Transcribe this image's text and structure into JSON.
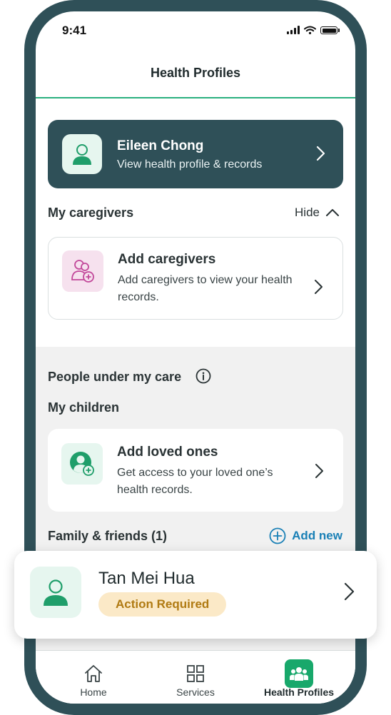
{
  "status_bar": {
    "time": "9:41"
  },
  "header": {
    "title": "Health Profiles"
  },
  "profile_card": {
    "name": "Eileen Chong",
    "subtitle": "View health profile & records"
  },
  "caregivers": {
    "section_title": "My caregivers",
    "toggle_label": "Hide",
    "card": {
      "title": "Add caregivers",
      "description": "Add caregivers to view your health records."
    }
  },
  "people_under_care": {
    "section_title": "People under my care",
    "children_title": "My children",
    "children_card": {
      "title": "Add loved ones",
      "description": "Get access to your loved one’s health records."
    },
    "family_title": "Family & friends (1)",
    "add_new_label": "Add new"
  },
  "family_member": {
    "name": "Tan Mei Hua",
    "status": "Action Required"
  },
  "bottom_nav": {
    "items": [
      {
        "label": "Home",
        "icon": "home-icon",
        "active": false
      },
      {
        "label": "Services",
        "icon": "grid-icon",
        "active": false
      },
      {
        "label": "Health Profiles",
        "icon": "people-icon",
        "active": true
      }
    ]
  },
  "colors": {
    "frame": "#2f5058",
    "accent_green": "#18a86b",
    "link_blue": "#1a80b6",
    "badge_bg": "#fbe9c7",
    "badge_text": "#b07a12"
  }
}
